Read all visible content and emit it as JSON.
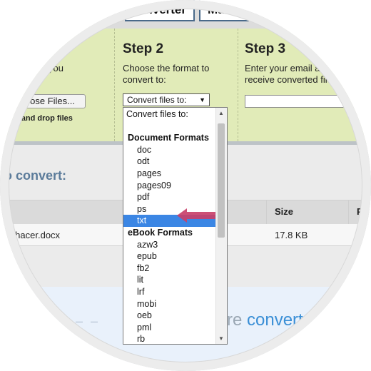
{
  "tabs": {
    "converter": "onverter",
    "manage": "Mana"
  },
  "step1": {
    "text_line1": "you",
    "text_line2": "",
    "choose_button": "ose Files...",
    "drag_text": "g and drop files"
  },
  "step2": {
    "title": "Step 2",
    "text_line1": "Choose the format to",
    "text_line2": "convert to:",
    "select_value": "Convert files to:"
  },
  "step3": {
    "title": "Step 3",
    "text_line1": "Enter your email ad",
    "text_line2": "receive converted file"
  },
  "section": {
    "title": "o convert:"
  },
  "table": {
    "headers": {
      "size": "Size",
      "partial": "P"
    },
    "row": {
      "name": "ra hacer.docx",
      "size": "17.8 KB",
      "partial": "F"
    }
  },
  "hero": {
    "text": "re ",
    "accent": "convert"
  },
  "dropdown": {
    "options": [
      {
        "label": "Convert files to:",
        "kind": "plain"
      },
      {
        "label": "",
        "kind": "plain"
      },
      {
        "label": "Document Formats",
        "kind": "group"
      },
      {
        "label": "doc",
        "kind": "item"
      },
      {
        "label": "odt",
        "kind": "item"
      },
      {
        "label": "pages",
        "kind": "item"
      },
      {
        "label": "pages09",
        "kind": "item"
      },
      {
        "label": "pdf",
        "kind": "item"
      },
      {
        "label": "ps",
        "kind": "item"
      },
      {
        "label": "txt",
        "kind": "item",
        "selected": true
      },
      {
        "label": "eBook Formats",
        "kind": "group"
      },
      {
        "label": "azw3",
        "kind": "item"
      },
      {
        "label": "epub",
        "kind": "item"
      },
      {
        "label": "fb2",
        "kind": "item"
      },
      {
        "label": "lit",
        "kind": "item"
      },
      {
        "label": "lrf",
        "kind": "item"
      },
      {
        "label": "mobi",
        "kind": "item"
      },
      {
        "label": "oeb",
        "kind": "item"
      },
      {
        "label": "pml",
        "kind": "item"
      },
      {
        "label": "rb",
        "kind": "item"
      }
    ]
  },
  "colors": {
    "panel": "#e1ebb8",
    "selection": "#3b86e4",
    "pointer": "#c9416a",
    "title_blue": "#5b7b9a"
  }
}
